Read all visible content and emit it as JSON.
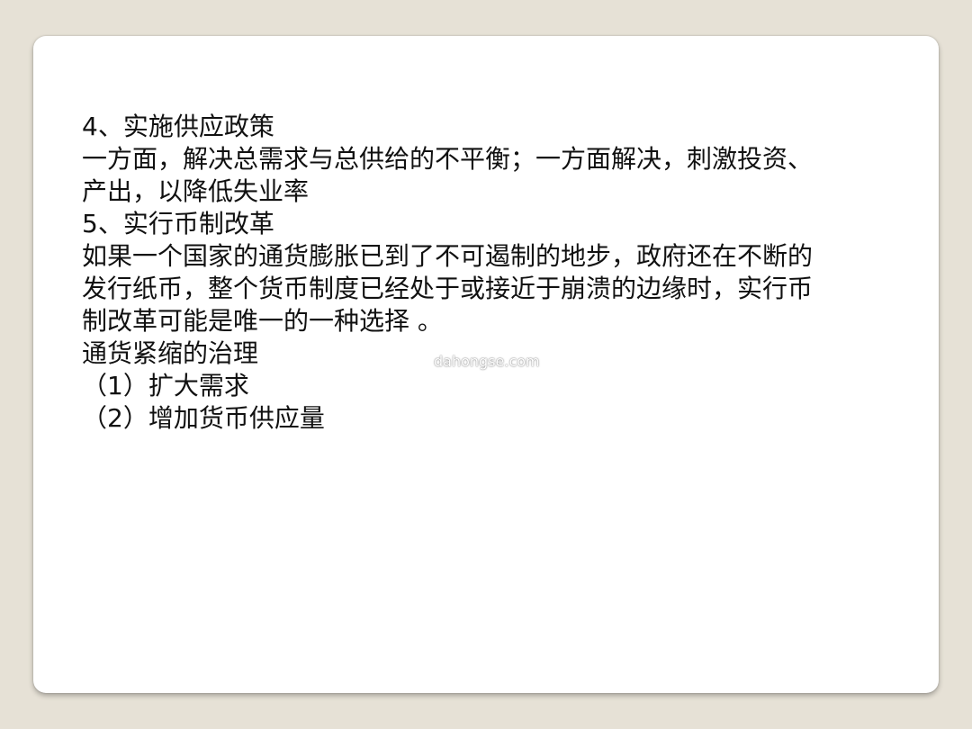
{
  "document": {
    "lines": [
      "4、实施供应政策",
      "一方面，解决总需求与总供给的不平衡；一方面解决，刺激投资、",
      "产出，以降低失业率",
      "5、实行币制改革",
      "如果一个国家的通货膨胀已到了不可遏制的地步，政府还在不断的",
      "发行纸币，整个货币制度已经处于或接近于崩溃的边缘时，实行币",
      "制改革可能是唯一的一种选择 。",
      "通货紧缩的治理",
      "（1）扩大需求",
      "（2）增加货币供应量"
    ]
  },
  "watermark": "dahongse.com",
  "colors": {
    "background": "#e6e1d6",
    "slide": "#ffffff",
    "text": "#111111"
  }
}
